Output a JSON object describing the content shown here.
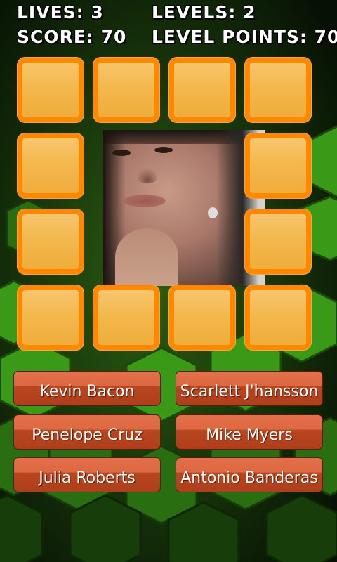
{
  "hud": {
    "lives_label": "LIVES:",
    "lives": "3",
    "levels_label": "LEVELS:",
    "levels": "2",
    "score_label": "SCORE:",
    "score": "70",
    "level_points_label": "LEVEL POINTS:",
    "level_points": "70"
  },
  "board": {
    "rows": 4,
    "cols": 4,
    "revealed_tiles": [
      [
        1,
        1
      ],
      [
        2,
        1
      ],
      [
        2,
        2
      ],
      [
        1,
        2
      ]
    ]
  },
  "answers": [
    {
      "label": "Kevin Bacon"
    },
    {
      "label": "Scarlett J'hansson"
    },
    {
      "label": "Penelope Cruz"
    },
    {
      "label": "Mike Myers"
    },
    {
      "label": "Julia Roberts"
    },
    {
      "label": "Antonio Banderas"
    }
  ],
  "colors": {
    "tile_border": "#ff8800",
    "tile_fill": "#f5bb52",
    "button": "#c8532b",
    "background": "#0a1a06",
    "hexagon": "#3fae1a"
  }
}
